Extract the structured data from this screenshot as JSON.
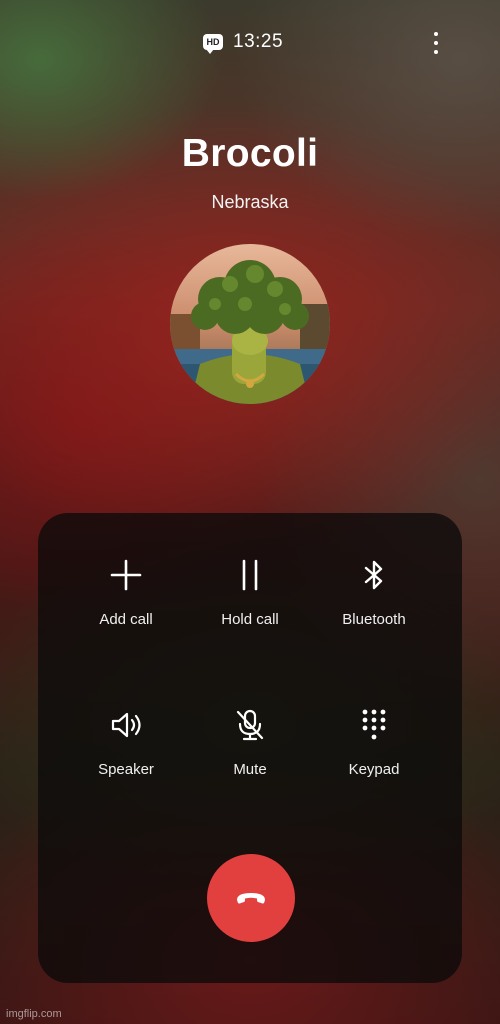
{
  "status_bar": {
    "hd_badge": "HD",
    "time": "13:25"
  },
  "caller": {
    "name": "Brocoli",
    "location": "Nebraska"
  },
  "controls": [
    {
      "label": "Add call",
      "icon": "plus-icon"
    },
    {
      "label": "Hold call",
      "icon": "pause-icon"
    },
    {
      "label": "Bluetooth",
      "icon": "bluetooth-icon"
    },
    {
      "label": "Speaker",
      "icon": "speaker-icon"
    },
    {
      "label": "Mute",
      "icon": "mic-off-icon"
    },
    {
      "label": "Keypad",
      "icon": "keypad-icon"
    }
  ],
  "end_call": {
    "icon": "phone-hangup-icon",
    "color": "#e2403e"
  },
  "watermark": "imgflip.com",
  "colors": {
    "end_call": "#e2403e",
    "panel_bg": "rgba(12,10,10,0.78)",
    "text": "#ffffff"
  }
}
